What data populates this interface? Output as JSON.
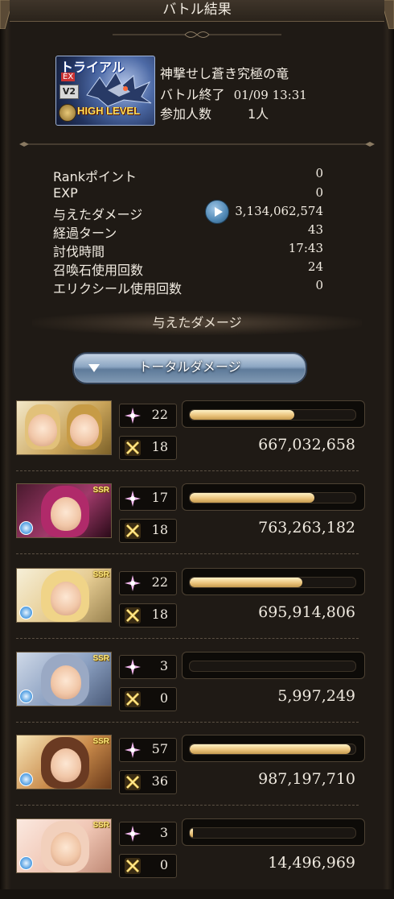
{
  "header": {
    "title": "バトル結果"
  },
  "quest": {
    "banner_trial": "トライアル",
    "banner_ex": "EX",
    "banner_version": "V2",
    "banner_level": "HIGH LEVEL",
    "name": "神撃せし蒼き究極の竜",
    "end_label": "バトル終了",
    "end_time": "01/09 13:31",
    "participants_label": "参加人数",
    "participants_value": "1人"
  },
  "stats": [
    {
      "label": "Rankポイント",
      "value": "0"
    },
    {
      "label": "EXP",
      "value": "0"
    },
    {
      "label": "与えたダメージ",
      "value": "3,134,062,574"
    },
    {
      "label": "経過ターン",
      "value": "43"
    },
    {
      "label": "討伐時間",
      "value": "17:43"
    },
    {
      "label": "召喚石使用回数",
      "value": "24"
    },
    {
      "label": "エリクシール使用回数",
      "value": "0"
    }
  ],
  "section": {
    "title": "与えたダメージ"
  },
  "total_button": {
    "label": "トータルダメージ"
  },
  "rows": [
    {
      "ssr": "",
      "attacks": "22",
      "specials": "18",
      "damage": "667,032,658",
      "bar": 0.63
    },
    {
      "ssr": "SSR",
      "attacks": "17",
      "specials": "18",
      "damage": "763,263,182",
      "bar": 0.75
    },
    {
      "ssr": "SSR",
      "attacks": "22",
      "specials": "18",
      "damage": "695,914,806",
      "bar": 0.68
    },
    {
      "ssr": "SSR",
      "attacks": "3",
      "specials": "0",
      "damage": "5,997,249",
      "bar": 0.0
    },
    {
      "ssr": "SSR",
      "attacks": "57",
      "specials": "36",
      "damage": "987,197,710",
      "bar": 0.97
    },
    {
      "ssr": "SSR",
      "attacks": "3",
      "specials": "0",
      "damage": "14,496,969",
      "bar": 0.02
    }
  ],
  "colors": {
    "accent": "#e8c078",
    "button": "#8ca6c2",
    "element_water": "#4a9ae0"
  },
  "icons": {
    "attack_badge": "sparkle-icon",
    "special_badge": "crossed-swords-icon",
    "damage_detail": "play-icon"
  }
}
